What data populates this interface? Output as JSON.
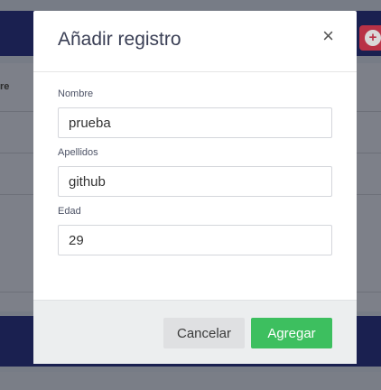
{
  "background": {
    "table_header_fragment": "re",
    "add_icon": "plus-icon"
  },
  "modal": {
    "title": "Añadir registro",
    "close_icon": "close-icon",
    "close_glyph": "×",
    "fields": [
      {
        "label": "Nombre",
        "value": "prueba"
      },
      {
        "label": "Apellidos",
        "value": "github"
      },
      {
        "label": "Edad",
        "value": "29"
      }
    ],
    "cancel_label": "Cancelar",
    "submit_label": "Agregar"
  },
  "colors": {
    "header_bg": "#1a2050",
    "accent_red": "#b93246",
    "primary_green": "#3dbf5f"
  }
}
